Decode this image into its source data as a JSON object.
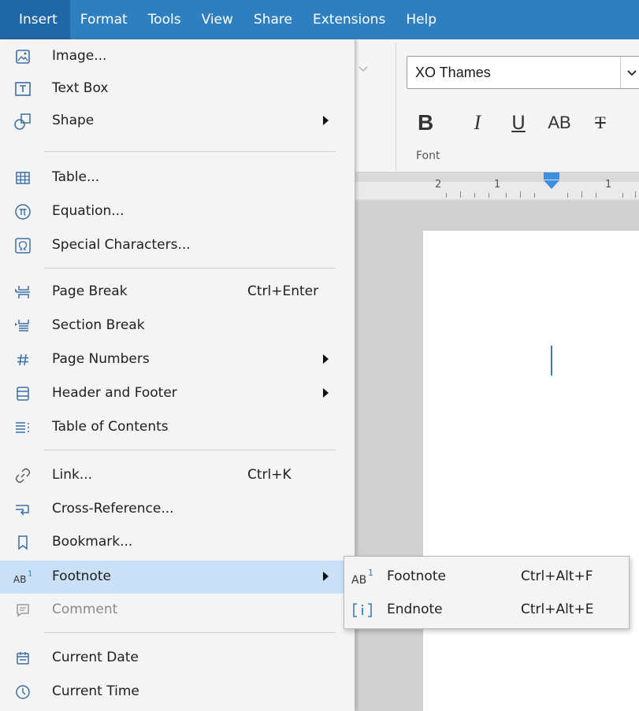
{
  "menubar": {
    "items": [
      {
        "label": "Insert",
        "active": true
      },
      {
        "label": "Format"
      },
      {
        "label": "Tools"
      },
      {
        "label": "View"
      },
      {
        "label": "Share"
      },
      {
        "label": "Extensions"
      },
      {
        "label": "Help"
      }
    ]
  },
  "ribbon": {
    "font_name": "XO Thames",
    "buttons": [
      "B",
      "I",
      "U",
      "AB",
      "T"
    ],
    "group_label": "Font"
  },
  "ruler": {
    "numbers": [
      "2",
      "1",
      "1"
    ]
  },
  "insert_menu": {
    "items": [
      {
        "label": "Image...",
        "icon": "image-icon"
      },
      {
        "label": "Text Box",
        "icon": "text-box-icon"
      },
      {
        "label": "Shape",
        "icon": "shape-icon",
        "submenu": true
      },
      {
        "label": "Table...",
        "icon": "table-icon"
      },
      {
        "label": "Equation...",
        "icon": "equation-icon"
      },
      {
        "label": "Special Characters...",
        "icon": "omega-icon"
      },
      {
        "label": "Page Break",
        "icon": "page-break-icon",
        "shortcut": "Ctrl+Enter"
      },
      {
        "label": "Section Break",
        "icon": "section-break-icon"
      },
      {
        "label": "Page Numbers",
        "icon": "hash-icon",
        "submenu": true
      },
      {
        "label": "Header and Footer",
        "icon": "header-footer-icon",
        "submenu": true
      },
      {
        "label": "Table of Contents",
        "icon": "toc-icon"
      },
      {
        "label": "Link...",
        "icon": "link-icon",
        "shortcut": "Ctrl+K"
      },
      {
        "label": "Cross-Reference...",
        "icon": "cross-reference-icon"
      },
      {
        "label": "Bookmark...",
        "icon": "bookmark-icon"
      },
      {
        "label": "Footnote",
        "icon": "footnote-icon",
        "submenu": true,
        "highlighted": true
      },
      {
        "label": "Comment",
        "icon": "comment-icon",
        "disabled": true
      },
      {
        "label": "Current Date",
        "icon": "calendar-icon"
      },
      {
        "label": "Current Time",
        "icon": "clock-icon"
      }
    ]
  },
  "footnote_submenu": {
    "items": [
      {
        "label": "Footnote",
        "shortcut": "Ctrl+Alt+F",
        "icon": "footnote-icon"
      },
      {
        "label": "Endnote",
        "shortcut": "Ctrl+Alt+E",
        "icon": "endnote-icon"
      }
    ]
  },
  "colors": {
    "menubar_bg": "#2e7fc0",
    "menubar_active": "#1f67a6",
    "highlight": "#c9e0f7",
    "icon": "#3a6ea5"
  }
}
